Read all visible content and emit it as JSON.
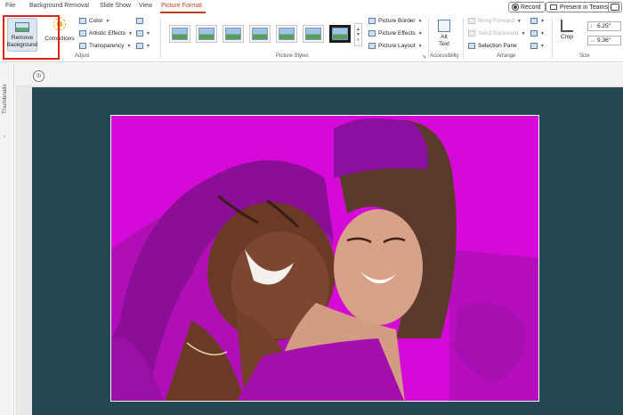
{
  "tabs": [
    {
      "label": "File",
      "active": false
    },
    {
      "label": "Background Removal",
      "active": false
    },
    {
      "label": "Slide Show",
      "active": false
    },
    {
      "label": "View",
      "active": false
    },
    {
      "label": "Picture Format",
      "active": true
    }
  ],
  "toolbar": {
    "record_label": "Record",
    "present_label": "Present in Teams"
  },
  "ribbon": {
    "adjust": {
      "remove_background_label": "Remove Background",
      "corrections_label": "Corrections",
      "color_label": "Color",
      "artistic_effects_label": "Artistic Effects",
      "transparency_label": "Transparency",
      "group_label": "Adjust"
    },
    "picture_styles": {
      "group_label": "Picture Styles",
      "border_label": "Picture Border",
      "effects_label": "Picture Effects",
      "layout_label": "Picture Layout"
    },
    "accessibility": {
      "alt_text_label": "Alt Text",
      "group_label": "Accessibility"
    },
    "arrange": {
      "bring_forward_label": "Bring Forward",
      "send_backward_label": "Send Backward",
      "selection_pane_label": "Selection Pane",
      "group_label": "Arrange"
    },
    "size": {
      "crop_label": "Crop",
      "height_value": "6.25\"",
      "width_value": "9.36\"",
      "group_label": "Size"
    }
  },
  "sidebar": {
    "thumbnails_label": "Thumbnails"
  },
  "colors": {
    "accent": "#c43e1c",
    "highlight": "#e02020",
    "slide_background": "#244754",
    "removal_overlay": "#d50ad8"
  }
}
